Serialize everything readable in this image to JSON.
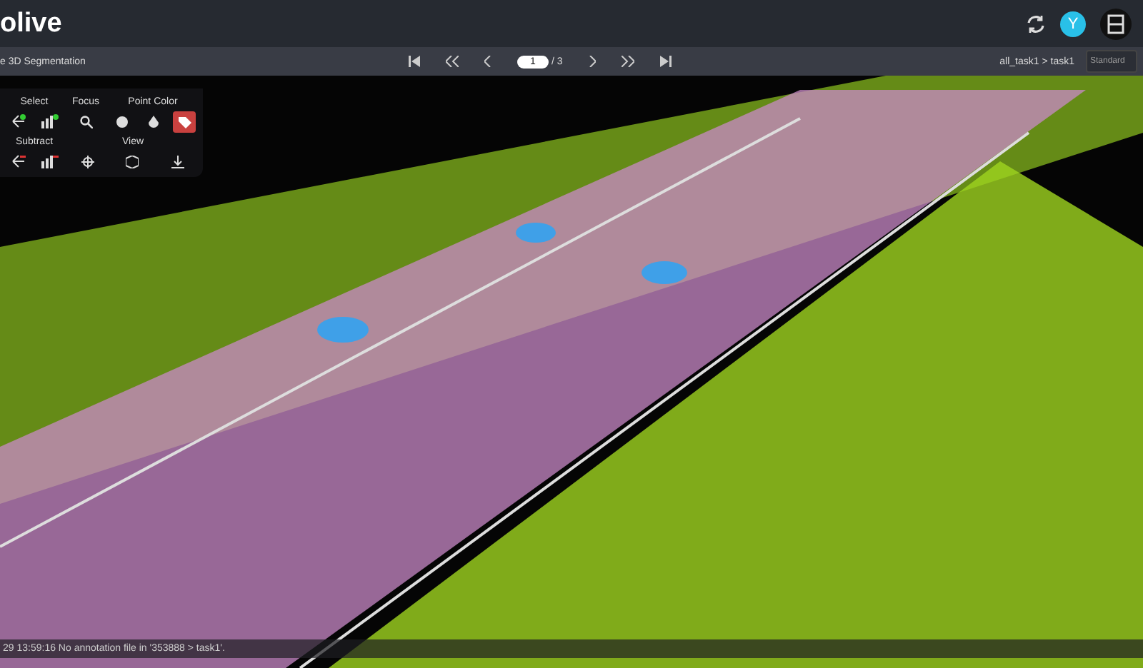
{
  "header": {
    "title": "olive",
    "avatar": "Y"
  },
  "toolbar": {
    "title": "e 3D Segmentation",
    "page_value": "1",
    "page_total": "/ 3",
    "breadcrumb": "all_task1 > task1",
    "mode_placeholder": "Standard"
  },
  "tool_panel": {
    "labels": [
      "Select",
      "Focus",
      "Point Color",
      "Subtract",
      "View"
    ],
    "point_color_modes": [
      {
        "selected": false
      },
      {
        "selected": false
      },
      {
        "selected": true
      }
    ]
  },
  "status_bar": {
    "message": "29 13:59:16 No annotation file in '353888 > task1'."
  }
}
